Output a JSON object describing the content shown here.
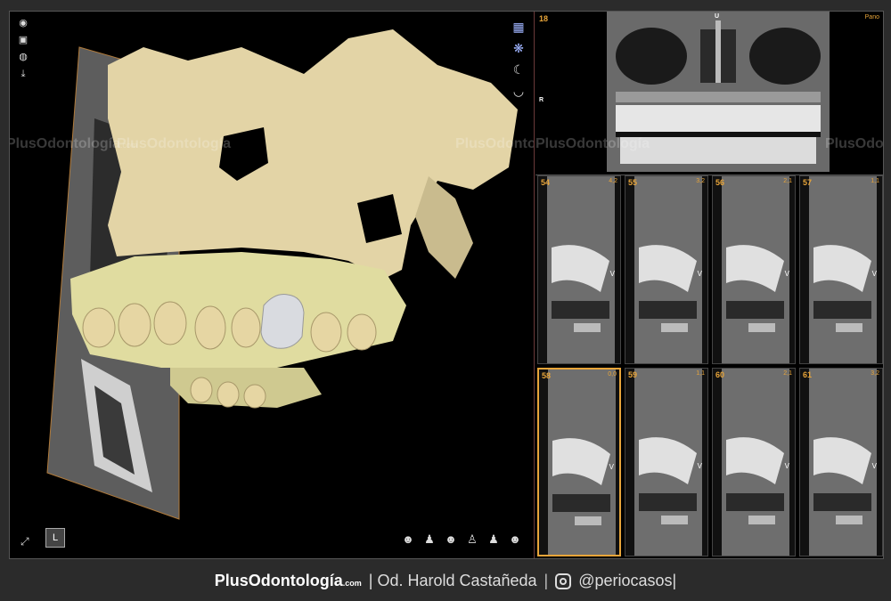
{
  "left_toolbar": [
    {
      "name": "camera-icon",
      "glyph": "◉"
    },
    {
      "name": "image-icon",
      "glyph": "▣"
    },
    {
      "name": "globe-icon",
      "glyph": "◍"
    },
    {
      "name": "download-icon",
      "glyph": "⤓"
    }
  ],
  "right_toolbar": [
    {
      "name": "grid-cube-icon",
      "glyph": "▦"
    },
    {
      "name": "skull-render-icon",
      "glyph": "❋"
    },
    {
      "name": "moon-icon",
      "glyph": "☾"
    },
    {
      "name": "bowl-icon",
      "glyph": "◡"
    }
  ],
  "bottom_toolbar": [
    {
      "name": "head-view-front-icon",
      "glyph": "☻"
    },
    {
      "name": "head-view-back-icon",
      "glyph": "♟"
    },
    {
      "name": "head-view-left-icon",
      "glyph": "☻"
    },
    {
      "name": "head-view-top-icon",
      "glyph": "♙"
    },
    {
      "name": "head-view-bottom-icon",
      "glyph": "♟"
    },
    {
      "name": "head-view-right-icon",
      "glyph": "☻"
    }
  ],
  "cube_label": "L",
  "watermark": {
    "brand": "PlusOdontología",
    "suffix": ".com"
  },
  "pano": {
    "slice_number": "18",
    "right_label": "Pano",
    "left_marker": "R",
    "top_marker": "U"
  },
  "cross_sections": [
    {
      "num": "54",
      "val": "4,2",
      "side": "V"
    },
    {
      "num": "55",
      "val": "3,2",
      "side": "V"
    },
    {
      "num": "56",
      "val": "2,1",
      "side": "V"
    },
    {
      "num": "57",
      "val": "1,1",
      "side": "V"
    },
    {
      "num": "58",
      "val": "0,0",
      "side": "V"
    },
    {
      "num": "59",
      "val": "1,1",
      "side": "V"
    },
    {
      "num": "60",
      "val": "2,1",
      "side": "V"
    },
    {
      "num": "61",
      "val": "3,2",
      "side": "V"
    }
  ],
  "footer": {
    "brand": "PlusOdontología",
    "brand_suffix": ".com",
    "author": "| Od. Harold Castañeda",
    "sep": "|",
    "handle": "@periocasos|"
  },
  "colors": {
    "accent": "#e8a53a",
    "bone": "#e3d4a6",
    "crown": "#d9dbe0"
  }
}
